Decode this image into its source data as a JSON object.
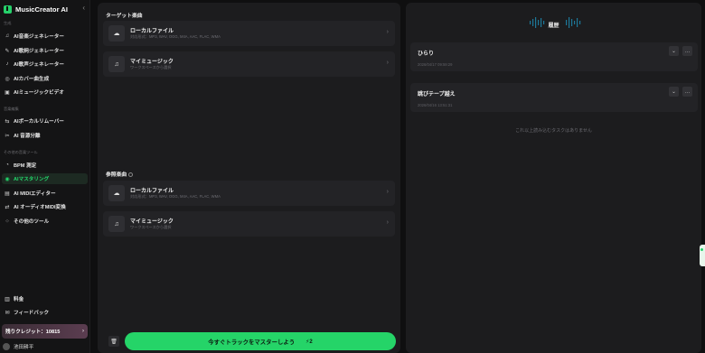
{
  "brand": {
    "name": "MusicCreator AI"
  },
  "sidebar": {
    "section_generate": "生成",
    "generate_items": [
      {
        "label": "AI音楽ジェネレーター",
        "icon": "music-note-icon"
      },
      {
        "label": "AI歌詞ジェネレーター",
        "icon": "pen-icon"
      },
      {
        "label": "AI歌声ジェネレーター",
        "icon": "mic-icon"
      },
      {
        "label": "AIカバー曲生成",
        "icon": "cover-icon"
      },
      {
        "label": "AIミュージックビデオ",
        "icon": "video-icon"
      }
    ],
    "section_edit": "音楽編集",
    "edit_items": [
      {
        "label": "AIボーカルリムーバー",
        "icon": "vocal-remover-icon"
      },
      {
        "label": "AI 音源分離",
        "icon": "stem-split-icon"
      }
    ],
    "section_other": "その他の音楽ツール",
    "other_items": [
      {
        "label": "BPM 測定",
        "icon": "bpm-icon"
      },
      {
        "label": "AIマスタリング",
        "icon": "mastering-icon",
        "active": true
      },
      {
        "label": "AI MIDIエディター",
        "icon": "midi-icon"
      },
      {
        "label": "AI オーディオMIDI変換",
        "icon": "audio-midi-icon"
      },
      {
        "label": "その他のツール",
        "icon": "more-tools-icon"
      }
    ],
    "footer_items": [
      {
        "label": "料金",
        "icon": "price-icon"
      },
      {
        "label": "フィードバック",
        "icon": "feedback-icon"
      }
    ],
    "credits": "残りクレジット：10815",
    "user_name": "池田耕平"
  },
  "center": {
    "target_title": "ターゲット楽曲",
    "target_sources": [
      {
        "title": "ローカルファイル",
        "sub": "対応形式：MP3, WAV, OGG, M4A, AAC, FLAC, WMA",
        "icon": "upload-cloud-icon"
      },
      {
        "title": "マイミュージック",
        "sub": "ワークスペースから選択",
        "icon": "music-note-icon"
      }
    ],
    "reference_title": "参照楽曲",
    "reference_sources": [
      {
        "title": "ローカルファイル",
        "sub": "対応形式：MP3, WAV, OGG, M4A, AAC, FLAC, WMA",
        "icon": "upload-cloud-icon"
      },
      {
        "title": "マイミュージック",
        "sub": "ワークスペースから選択",
        "icon": "music-note-icon"
      }
    ],
    "master_button": "今すぐトラックをマスターしよう",
    "master_cost": "2"
  },
  "history": {
    "title": "履歴",
    "items": [
      {
        "title": "ひらり",
        "date": "2026/04/17 09:59:29"
      },
      {
        "title": "跳びテープ越え",
        "date": "2026/04/16 13:51:31"
      }
    ],
    "end_message": "これ以上読み込むタスクはありません"
  },
  "colors": {
    "accent": "#25d468",
    "panel": "#1c1c1e",
    "card": "#232326"
  }
}
